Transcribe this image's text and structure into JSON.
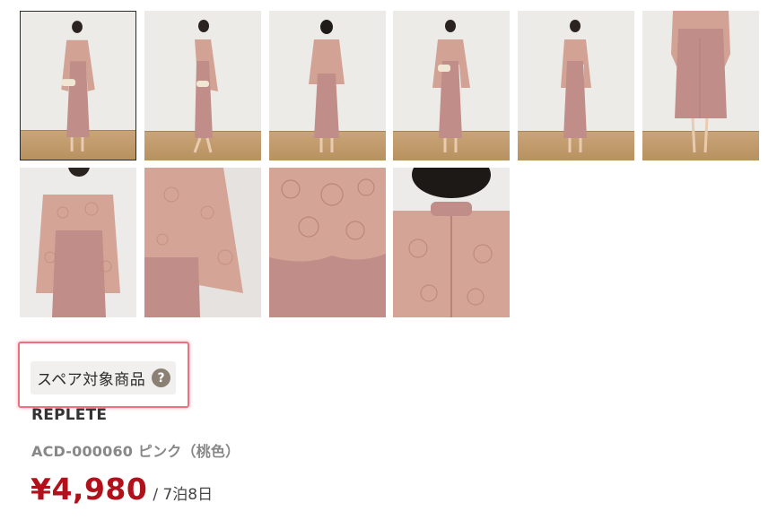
{
  "gallery": {
    "row1": [
      {
        "alt": "front-with-clutch",
        "selected": true
      },
      {
        "alt": "side"
      },
      {
        "alt": "back"
      },
      {
        "alt": "front-3"
      },
      {
        "alt": "front-4"
      },
      {
        "alt": "lower-body"
      }
    ],
    "row2": [
      {
        "alt": "upper-body"
      },
      {
        "alt": "sleeve-detail"
      },
      {
        "alt": "lace-detail"
      },
      {
        "alt": "back-neck-detail"
      }
    ]
  },
  "badge": {
    "label": "スペア対象商品",
    "help_icon": "?"
  },
  "product": {
    "brand": "REPLETE",
    "code_color": "ACD-000060 ピンク（桃色）",
    "price": "¥4,980",
    "rental_period": "/ 7泊8日"
  },
  "colors": {
    "accent_price": "#b1111b",
    "highlight_border": "#ef6f80",
    "dress": "#c9958f",
    "lace": "#d4a596"
  }
}
